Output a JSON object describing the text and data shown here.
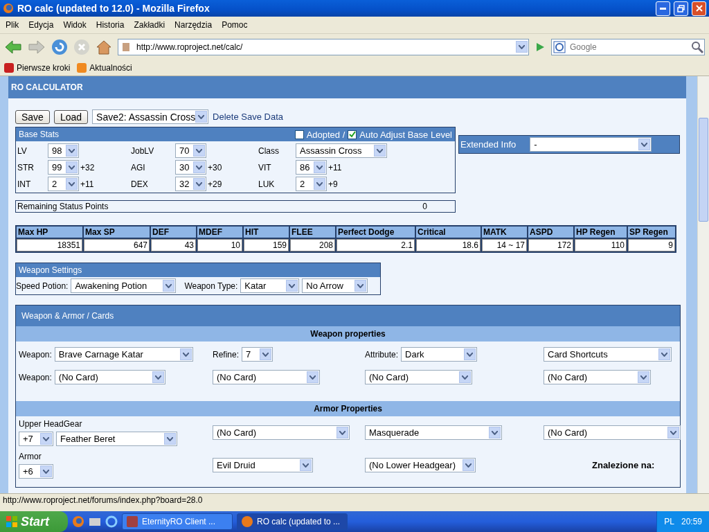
{
  "window": {
    "title": "RO calc (updated to 12.0) - Mozilla Firefox"
  },
  "menu": [
    "Plik",
    "Edycja",
    "Widok",
    "Historia",
    "Zakładki",
    "Narzędzia",
    "Pomoc"
  ],
  "address": {
    "value": "http://www.roproject.net/calc/"
  },
  "search": {
    "placeholder": "Google"
  },
  "bookmarks": [
    "Pierwsze kroki",
    "Aktualności"
  ],
  "page": {
    "title": "RO CALCULATOR",
    "save_bar": {
      "buttons": [
        "Save",
        "Load"
      ],
      "save_slot": "Save2: Assassin Cross",
      "delete_link": "Delete Save Data"
    },
    "base_stats": {
      "title": "Base Stats",
      "adopted": {
        "label": "Adopted /",
        "checked": false
      },
      "auto_adjust": {
        "label": "Auto Adjust Base Level",
        "checked": true
      },
      "cells": [
        {
          "label": "LV",
          "value": "98"
        },
        {
          "label": "JobLV",
          "value": "70"
        },
        {
          "label": "Class",
          "value": "Assassin Cross",
          "kind": "wide"
        },
        {
          "label": "STR",
          "value": "99",
          "bonus": "+32"
        },
        {
          "label": "AGI",
          "value": "30",
          "bonus": "+30"
        },
        {
          "label": "VIT",
          "value": "86",
          "bonus": "+11"
        },
        {
          "label": "INT",
          "value": "2",
          "bonus": "+11"
        },
        {
          "label": "DEX",
          "value": "32",
          "bonus": "+29"
        },
        {
          "label": "LUK",
          "value": "2",
          "bonus": "+9"
        }
      ]
    },
    "extended_info": {
      "label": "Extended Info",
      "value": "-"
    },
    "remaining": {
      "label": "Remaining Status Points",
      "value": "0"
    },
    "stats_table": {
      "columns": [
        "Max HP",
        "Max SP",
        "DEF",
        "MDEF",
        "HIT",
        "FLEE",
        "Perfect Dodge",
        "Critical",
        "MATK",
        "ASPD",
        "HP Regen",
        "SP Regen"
      ],
      "values": [
        "18351",
        "647",
        "43",
        "10",
        "159",
        "208",
        "2.1",
        "18.6",
        "14 ~ 17",
        "172",
        "110",
        "9"
      ]
    },
    "weapon_settings": {
      "title": "Weapon Settings",
      "speed_potion": {
        "label": "Speed Potion:",
        "value": "Awakening Potion"
      },
      "weapon_type": {
        "label": "Weapon Type:",
        "value": "Katar"
      },
      "arrow": "No Arrow"
    },
    "equipment": {
      "title": "Weapon & Armor / Cards",
      "sections": [
        {
          "title": "Weapon properties",
          "rows": [
            [
              [
                {
                  "kind": "label",
                  "text": "Weapon:"
                },
                {
                  "kind": "select",
                  "text": "Brave Carnage Katar"
                }
              ],
              [
                {
                  "kind": "label",
                  "text": "Refine:"
                },
                {
                  "kind": "select",
                  "text": "7"
                }
              ],
              [
                {
                  "kind": "label",
                  "text": "Attribute:"
                },
                {
                  "kind": "select",
                  "text": "Dark"
                }
              ],
              [
                {
                  "kind": "select",
                  "text": "Card Shortcuts"
                }
              ]
            ],
            [
              [
                {
                  "kind": "label",
                  "text": "Weapon:"
                },
                {
                  "kind": "select",
                  "text": "(No Card)"
                }
              ],
              [
                {
                  "kind": "select",
                  "text": "(No Card)"
                }
              ],
              [
                {
                  "kind": "select",
                  "text": "(No Card)"
                }
              ],
              [
                {
                  "kind": "select",
                  "text": "(No Card)"
                }
              ]
            ]
          ]
        },
        {
          "title": "Armor Properties",
          "rows": [
            [
              [
                {
                  "kind": "caption",
                  "text": "Upper HeadGear"
                },
                {
                  "kind": "select",
                  "text": "+7"
                },
                {
                  "kind": "select",
                  "text": "Feather Beret"
                }
              ],
              [
                {
                  "kind": "select",
                  "text": "(No Card)"
                }
              ],
              [
                {
                  "kind": "select",
                  "text": "Masquerade"
                }
              ],
              [
                {
                  "kind": "select",
                  "text": "(No Card)"
                }
              ]
            ],
            [
              [
                {
                  "kind": "caption",
                  "text": "Armor"
                },
                {
                  "kind": "select",
                  "text": "+6"
                }
              ],
              [
                {
                  "kind": "select",
                  "text": "Evil Druid"
                }
              ],
              [
                {
                  "kind": "select",
                  "text": "(No Lower Headgear)"
                }
              ],
              [
                {
                  "kind": "note",
                  "text": "Znalezione na:"
                }
              ]
            ]
          ]
        }
      ]
    }
  },
  "status_bar": "http://www.roproject.net/forums/index.php?board=28.0",
  "taskbar": {
    "start": "Start",
    "tasks": [
      {
        "label": "EternityRO Client     ...",
        "selected": false
      },
      {
        "label": "RO calc (updated to ...",
        "selected": true
      }
    ],
    "language": "PL",
    "time": "20:59"
  }
}
